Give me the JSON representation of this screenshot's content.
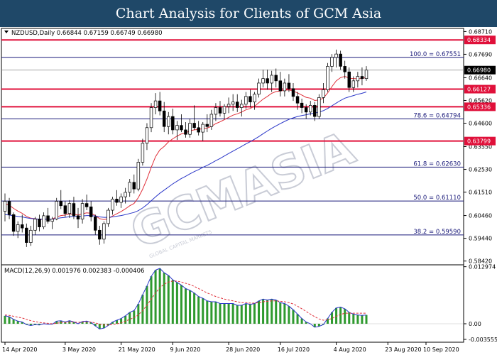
{
  "banner": {
    "title": "Chart Analysis for Clients of GCM Asia"
  },
  "chart_data": {
    "type": "candlestick",
    "symbol_info": "NZDUSD,Daily  0.66844 0.67159 0.66749 0.66980",
    "watermark": "GCMASIA",
    "watermark_sub": "GLOBAL CAPITAL MARKETS",
    "price_axis": {
      "range": [
        0.5825,
        0.6885
      ],
      "ticks": [
        0.6871,
        0.6769,
        0.6664,
        0.6562,
        0.646,
        0.6355,
        0.6253,
        0.6151,
        0.6046,
        0.5944,
        0.5842
      ]
    },
    "red_levels": [
      {
        "value": 0.68334,
        "label": "0.68334"
      },
      {
        "value": 0.66127,
        "label": "0.66127"
      },
      {
        "value": 0.65336,
        "label": "0.65336"
      },
      {
        "value": 0.63799,
        "label": "0.63799"
      }
    ],
    "current_price": {
      "value": 0.6698,
      "label": "0.66980"
    },
    "fibonacci": [
      {
        "value": 0.67551,
        "label": "100.0 = 0.67551"
      },
      {
        "value": 0.64794,
        "label": "78.6 = 0.64794"
      },
      {
        "value": 0.6263,
        "label": "61.8 = 0.62630"
      },
      {
        "value": 0.6111,
        "label": "50.0 = 0.61110"
      },
      {
        "value": 0.5959,
        "label": "38.2 = 0.59590"
      }
    ],
    "candles": [
      [
        0.6065,
        0.6145,
        0.602,
        0.611
      ],
      [
        0.611,
        0.6125,
        0.603,
        0.605
      ],
      [
        0.605,
        0.606,
        0.5955,
        0.5975
      ],
      [
        0.5975,
        0.602,
        0.5945,
        0.6005
      ],
      [
        0.6005,
        0.605,
        0.597,
        0.599
      ],
      [
        0.599,
        0.601,
        0.5905,
        0.5925
      ],
      [
        0.5925,
        0.6,
        0.591,
        0.598
      ],
      [
        0.598,
        0.604,
        0.596,
        0.603
      ],
      [
        0.603,
        0.605,
        0.5975,
        0.5995
      ],
      [
        0.5995,
        0.606,
        0.5985,
        0.6045
      ],
      [
        0.6045,
        0.608,
        0.601,
        0.602
      ],
      [
        0.602,
        0.604,
        0.5985,
        0.603
      ],
      [
        0.603,
        0.6125,
        0.6025,
        0.611
      ],
      [
        0.611,
        0.616,
        0.6075,
        0.609
      ],
      [
        0.609,
        0.611,
        0.604,
        0.6055
      ],
      [
        0.6055,
        0.6115,
        0.6035,
        0.61
      ],
      [
        0.61,
        0.613,
        0.603,
        0.6045
      ],
      [
        0.6045,
        0.608,
        0.599,
        0.603
      ],
      [
        0.603,
        0.612,
        0.601,
        0.61
      ],
      [
        0.61,
        0.614,
        0.607,
        0.6085
      ],
      [
        0.6085,
        0.611,
        0.602,
        0.604
      ],
      [
        0.604,
        0.605,
        0.596,
        0.598
      ],
      [
        0.598,
        0.6,
        0.5915,
        0.594
      ],
      [
        0.594,
        0.602,
        0.592,
        0.601
      ],
      [
        0.601,
        0.608,
        0.5995,
        0.607
      ],
      [
        0.607,
        0.613,
        0.605,
        0.612
      ],
      [
        0.612,
        0.616,
        0.609,
        0.6105
      ],
      [
        0.6105,
        0.6145,
        0.608,
        0.613
      ],
      [
        0.613,
        0.617,
        0.61,
        0.615
      ],
      [
        0.615,
        0.621,
        0.613,
        0.6195
      ],
      [
        0.6195,
        0.623,
        0.6145,
        0.6165
      ],
      [
        0.6165,
        0.63,
        0.6155,
        0.6285
      ],
      [
        0.6285,
        0.639,
        0.627,
        0.637
      ],
      [
        0.637,
        0.646,
        0.634,
        0.644
      ],
      [
        0.644,
        0.655,
        0.642,
        0.653
      ],
      [
        0.653,
        0.6595,
        0.65,
        0.656
      ],
      [
        0.656,
        0.66,
        0.6495,
        0.6515
      ],
      [
        0.6515,
        0.6555,
        0.642,
        0.6445
      ],
      [
        0.6445,
        0.651,
        0.641,
        0.649
      ],
      [
        0.649,
        0.6525,
        0.641,
        0.643
      ],
      [
        0.643,
        0.647,
        0.6385,
        0.645
      ],
      [
        0.645,
        0.65,
        0.642,
        0.643
      ],
      [
        0.643,
        0.6465,
        0.6395,
        0.641
      ],
      [
        0.641,
        0.648,
        0.6395,
        0.646
      ],
      [
        0.646,
        0.654,
        0.643,
        0.644
      ],
      [
        0.644,
        0.647,
        0.6405,
        0.642
      ],
      [
        0.642,
        0.6465,
        0.638,
        0.6455
      ],
      [
        0.6455,
        0.65,
        0.642,
        0.6445
      ],
      [
        0.6445,
        0.652,
        0.643,
        0.65
      ],
      [
        0.65,
        0.655,
        0.647,
        0.653
      ],
      [
        0.653,
        0.656,
        0.649,
        0.6505
      ],
      [
        0.6505,
        0.6545,
        0.648,
        0.6535
      ],
      [
        0.6535,
        0.6575,
        0.6505,
        0.6545
      ],
      [
        0.6545,
        0.659,
        0.6515,
        0.6555
      ],
      [
        0.6555,
        0.659,
        0.651,
        0.653
      ],
      [
        0.653,
        0.6565,
        0.649,
        0.6545
      ],
      [
        0.6545,
        0.66,
        0.6525,
        0.658
      ],
      [
        0.658,
        0.661,
        0.653,
        0.6555
      ],
      [
        0.6555,
        0.66,
        0.652,
        0.659
      ],
      [
        0.659,
        0.666,
        0.6575,
        0.664
      ],
      [
        0.664,
        0.67,
        0.662,
        0.666
      ],
      [
        0.666,
        0.67,
        0.661,
        0.664
      ],
      [
        0.664,
        0.6695,
        0.66,
        0.6675
      ],
      [
        0.6675,
        0.6705,
        0.662,
        0.665
      ],
      [
        0.665,
        0.669,
        0.658,
        0.6605
      ],
      [
        0.6605,
        0.666,
        0.658,
        0.664
      ],
      [
        0.664,
        0.668,
        0.66,
        0.6615
      ],
      [
        0.6615,
        0.664,
        0.656,
        0.658
      ],
      [
        0.658,
        0.66,
        0.652,
        0.655
      ],
      [
        0.655,
        0.657,
        0.6505,
        0.653
      ],
      [
        0.653,
        0.6545,
        0.648,
        0.651
      ],
      [
        0.651,
        0.656,
        0.6495,
        0.654
      ],
      [
        0.654,
        0.6555,
        0.647,
        0.649
      ],
      [
        0.649,
        0.659,
        0.648,
        0.6575
      ],
      [
        0.6575,
        0.664,
        0.655,
        0.661
      ],
      [
        0.661,
        0.673,
        0.66,
        0.6715
      ],
      [
        0.6715,
        0.677,
        0.669,
        0.6755
      ],
      [
        0.6755,
        0.679,
        0.671,
        0.677
      ],
      [
        0.677,
        0.6785,
        0.67,
        0.6715
      ],
      [
        0.6715,
        0.674,
        0.666,
        0.669
      ],
      [
        0.669,
        0.671,
        0.66,
        0.662
      ],
      [
        0.662,
        0.667,
        0.66,
        0.665
      ],
      [
        0.665,
        0.669,
        0.662,
        0.667
      ],
      [
        0.667,
        0.671,
        0.663,
        0.666
      ],
      [
        0.666,
        0.6716,
        0.665,
        0.6698
      ]
    ],
    "series": [
      {
        "name": "fast ma",
        "color": "#e0303a",
        "values": [
          0.61,
          0.6092,
          0.6078,
          0.6066,
          0.6056,
          0.6042,
          0.6034,
          0.6032,
          0.6028,
          0.603,
          0.603,
          0.603,
          0.604,
          0.6046,
          0.6048,
          0.6053,
          0.6052,
          0.6048,
          0.6054,
          0.6058,
          0.6056,
          0.6046,
          0.6032,
          0.6028,
          0.6032,
          0.6044,
          0.6054,
          0.6064,
          0.6076,
          0.609,
          0.61,
          0.6126,
          0.6164,
          0.621,
          0.6262,
          0.631,
          0.634,
          0.6356,
          0.6376,
          0.639,
          0.6402,
          0.6412,
          0.6416,
          0.6426,
          0.643,
          0.6432,
          0.6436,
          0.6438,
          0.6446,
          0.6458,
          0.6466,
          0.6476,
          0.6486,
          0.6496,
          0.6502,
          0.651,
          0.652,
          0.6526,
          0.6536,
          0.6552,
          0.6568,
          0.658,
          0.6594,
          0.6602,
          0.6604,
          0.6608,
          0.6609,
          0.6604,
          0.6596,
          0.6586,
          0.6576,
          0.6572,
          0.6562,
          0.6564,
          0.6572,
          0.6596,
          0.6624,
          0.665,
          0.6664,
          0.667,
          0.6662,
          0.666,
          0.666,
          0.666,
          0.6666
        ]
      },
      {
        "name": "slow ma",
        "color": "#2a36c8",
        "values": [
          0.605,
          0.6048,
          0.6045,
          0.6042,
          0.604,
          0.6036,
          0.6033,
          0.6031,
          0.603,
          0.603,
          0.603,
          0.603,
          0.6033,
          0.6036,
          0.6038,
          0.6041,
          0.6042,
          0.6042,
          0.6044,
          0.6046,
          0.6046,
          0.6044,
          0.604,
          0.6038,
          0.6038,
          0.604,
          0.6043,
          0.6046,
          0.605,
          0.6055,
          0.606,
          0.6068,
          0.608,
          0.6095,
          0.6112,
          0.613,
          0.6146,
          0.616,
          0.6174,
          0.6188,
          0.62,
          0.6212,
          0.6222,
          0.6233,
          0.6243,
          0.6252,
          0.6262,
          0.6271,
          0.6281,
          0.6292,
          0.6302,
          0.6313,
          0.6324,
          0.6335,
          0.6345,
          0.6356,
          0.6367,
          0.6377,
          0.6388,
          0.64,
          0.6413,
          0.6425,
          0.6437,
          0.6448,
          0.6458,
          0.6468,
          0.6477,
          0.6484,
          0.649,
          0.6494,
          0.6498,
          0.6502,
          0.6505,
          0.651,
          0.6516,
          0.6526,
          0.6538,
          0.655,
          0.6562,
          0.6572,
          0.6578,
          0.6584,
          0.659,
          0.6594,
          0.66
        ]
      }
    ],
    "macd": {
      "label": "MACD(12,26,9) 0.001976 0.002383 -0.000406",
      "range": [
        -0.0042,
        0.0134
      ],
      "ticks": [
        {
          "value": 0.012974,
          "label": "0.012974"
        },
        {
          "value": 0.0,
          "label": "0.00"
        },
        {
          "value": -0.003555,
          "label": "-0.003555"
        }
      ],
      "macd_line": [
        0.0018,
        0.0016,
        0.001,
        0.0006,
        0.0004,
        -0.0002,
        -0.0004,
        -0.0002,
        -0.0003,
        0.0,
        -0.0001,
        -0.0001,
        0.0006,
        0.0007,
        0.0004,
        0.0007,
        0.0004,
        0.0,
        0.0005,
        0.0006,
        0.0003,
        -0.0005,
        -0.0012,
        -0.001,
        -0.0004,
        0.0004,
        0.0008,
        0.0012,
        0.0018,
        0.0026,
        0.003,
        0.0045,
        0.0066,
        0.0086,
        0.0108,
        0.0122,
        0.0126,
        0.0116,
        0.011,
        0.01,
        0.0094,
        0.0088,
        0.008,
        0.0076,
        0.007,
        0.0062,
        0.0058,
        0.0052,
        0.005,
        0.005,
        0.0046,
        0.0046,
        0.0046,
        0.0046,
        0.0042,
        0.0042,
        0.0046,
        0.0044,
        0.0046,
        0.0052,
        0.0056,
        0.0054,
        0.0056,
        0.0054,
        0.0048,
        0.0046,
        0.004,
        0.0032,
        0.0022,
        0.0012,
        0.0004,
        0.0,
        -0.0008,
        -0.0006,
        -0.0002,
        0.0012,
        0.0026,
        0.0036,
        0.0038,
        0.0034,
        0.0026,
        0.0022,
        0.002,
        0.0019,
        0.002
      ],
      "signal_line": [
        0.002,
        0.0019,
        0.0017,
        0.0015,
        0.0013,
        0.001,
        0.0007,
        0.0005,
        0.0003,
        0.0002,
        0.0001,
        0.0,
        0.0001,
        0.0003,
        0.0003,
        0.0004,
        0.0004,
        0.0003,
        0.0004,
        0.0004,
        0.0004,
        0.0002,
        -0.0001,
        -0.0003,
        -0.0003,
        -0.0002,
        0.0,
        0.0002,
        0.0006,
        0.001,
        0.0014,
        0.002,
        0.003,
        0.0042,
        0.0056,
        0.007,
        0.0082,
        0.009,
        0.0095,
        0.0097,
        0.0097,
        0.0095,
        0.0092,
        0.0089,
        0.0085,
        0.008,
        0.0075,
        0.007,
        0.0066,
        0.0062,
        0.0059,
        0.0056,
        0.0054,
        0.0052,
        0.005,
        0.0048,
        0.0048,
        0.0047,
        0.0047,
        0.0048,
        0.005,
        0.0051,
        0.0052,
        0.0052,
        0.0051,
        0.005,
        0.0048,
        0.0045,
        0.004,
        0.0034,
        0.0028,
        0.0022,
        0.0016,
        0.0011,
        0.0008,
        0.0009,
        0.0012,
        0.0017,
        0.0021,
        0.0024,
        0.0024,
        0.0024,
        0.0024,
        0.0024,
        0.0024
      ]
    },
    "date_labels": [
      {
        "index": 0,
        "label": "14 Apr 2020"
      },
      {
        "index": 14,
        "label": "3 May 2020"
      },
      {
        "index": 27,
        "label": "21 May 2020"
      },
      {
        "index": 39,
        "label": "9 Jun 2020"
      },
      {
        "index": 52,
        "label": "28 Jun 2020"
      },
      {
        "index": 64,
        "label": "16 Jul 2020"
      },
      {
        "index": 77,
        "label": "4 Aug 2020"
      },
      {
        "index": 89,
        "label": "23 Aug 2020"
      },
      {
        "index": 101,
        "label": "10 Sep 2020"
      }
    ],
    "colors": {
      "banner": "#1f4868",
      "red_level": "#e0103a",
      "fib": "#1a1a7a",
      "current_price": "#000000",
      "histogram": "#2f9a2f",
      "macd_line": "#2a36c8",
      "signal_line": "#e0303a"
    }
  }
}
